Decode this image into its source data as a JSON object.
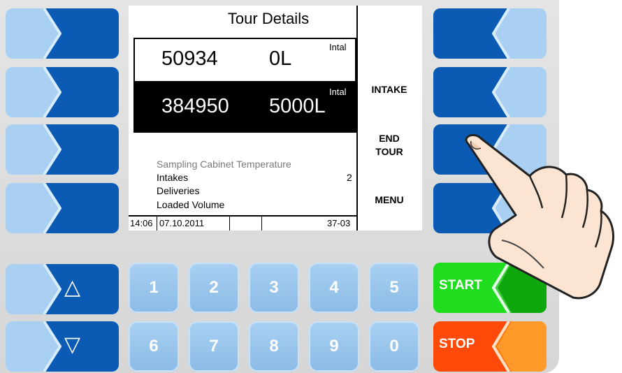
{
  "screen": {
    "title": "Tour Details",
    "rows": [
      {
        "id": "50934",
        "volume": "0L",
        "type": "Intal"
      },
      {
        "id": "384950",
        "volume": "5000L",
        "type": "Intal"
      }
    ],
    "info": [
      "Sampling Cabinet Temperature",
      "Intakes",
      "Deliveries",
      "Loaded Volume"
    ],
    "intakes_count": "2",
    "softkeys": {
      "intake": "INTAKE",
      "end_tour_1": "END",
      "end_tour_2": "TOUR",
      "menu": "MENU"
    },
    "status": {
      "time": "14:06",
      "date": "07.10.2011",
      "code": "37-03"
    }
  },
  "keypad": {
    "up": "△",
    "down": "▽",
    "numbers": [
      "1",
      "2",
      "3",
      "4",
      "5",
      "6",
      "7",
      "8",
      "9",
      "0"
    ],
    "start": "START",
    "stop": "STOP"
  },
  "colors": {
    "softkey_blue": "#0b5bb5",
    "softkey_light": "#a9d0f2",
    "start": "#1fbf1f",
    "stop": "#ff7f1a"
  }
}
